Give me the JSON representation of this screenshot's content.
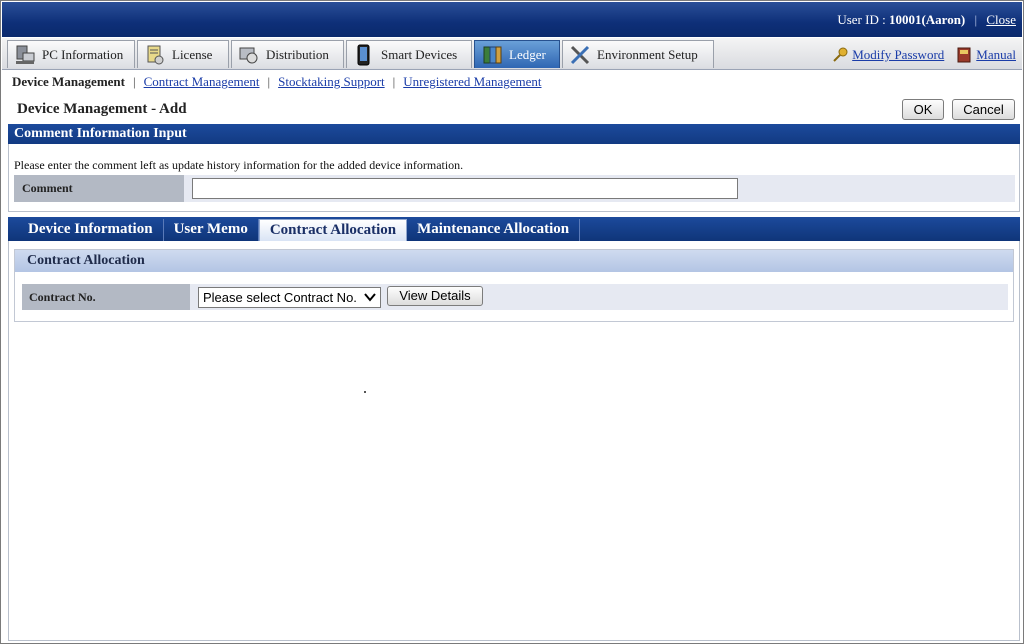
{
  "header": {
    "user_label": "User ID : ",
    "user_id": "10001(Aaron)",
    "close_label": "Close"
  },
  "main_nav": {
    "tabs": [
      {
        "label": "PC Information",
        "icon": "pc-icon"
      },
      {
        "label": "License",
        "icon": "license-icon"
      },
      {
        "label": "Distribution",
        "icon": "distribution-icon"
      },
      {
        "label": "Smart Devices",
        "icon": "smartphone-icon"
      },
      {
        "label": "Ledger",
        "icon": "ledger-icon",
        "active": true
      },
      {
        "label": "Environment Setup",
        "icon": "tools-icon"
      }
    ],
    "modify_password": "Modify Password",
    "manual": "Manual"
  },
  "sub_nav": {
    "current": "Device Management",
    "links": [
      "Contract Management",
      "Stocktaking Support",
      "Unregistered Management"
    ]
  },
  "page": {
    "title": "Device Management - Add",
    "ok_label": "OK",
    "cancel_label": "Cancel"
  },
  "comment_section": {
    "heading": "Comment Information Input",
    "instruction": "Please enter the comment left as update history information for the added device information.",
    "comment_label": "Comment",
    "comment_value": ""
  },
  "tabs": [
    {
      "label": "Device Information"
    },
    {
      "label": "User Memo"
    },
    {
      "label": "Contract Allocation",
      "active": true
    },
    {
      "label": "Maintenance Allocation"
    }
  ],
  "contract_allocation": {
    "heading": "Contract Allocation",
    "contract_no_label": "Contract No.",
    "select_value": "Please select Contract No.",
    "view_details_label": "View Details"
  },
  "colors": {
    "header_blue": "#0e2f78",
    "active_tab": "#2f66b3",
    "link": "#1a3ca8"
  }
}
